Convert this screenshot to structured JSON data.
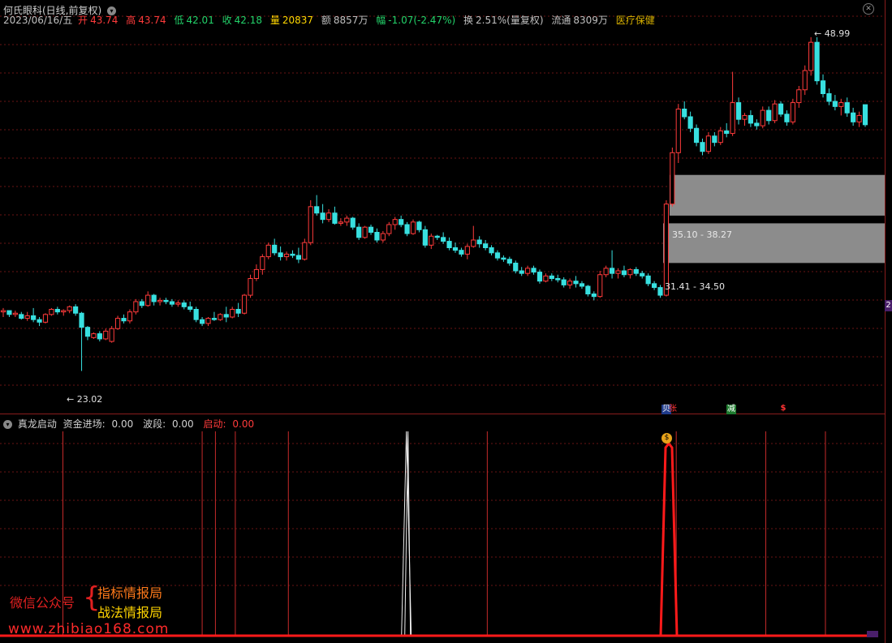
{
  "header": {
    "title": "何氏眼科(日线,前复权)",
    "expand_icon": "chevron-down-icon"
  },
  "quote": {
    "date": "2023/06/16/五",
    "open_label": "开",
    "open": "43.74",
    "high_label": "高",
    "high": "43.74",
    "low_label": "低",
    "low": "42.01",
    "close_label": "收",
    "close": "42.18",
    "vol_label": "量",
    "vol": "20837",
    "amount_label": "额",
    "amount": "8857万",
    "chg_label": "幅",
    "chg": "-1.07(-2.47%)",
    "turnover_label": "换",
    "turnover": "2.51%(量复权)",
    "float_label": "流通",
    "float": "8309万",
    "sector": "医疗保健"
  },
  "annotations": {
    "high_mark": "48.99",
    "low_mark": "23.02",
    "zone_upper": "35.10 - 38.27",
    "zone_lower": "31.41 - 34.50",
    "axis_tag": "2"
  },
  "badges": {
    "buy": "贝",
    "rise": "张",
    "reduce": "减",
    "sell": "$"
  },
  "indicator": {
    "name": "真龙启动",
    "field1_label": "资金进场:",
    "field1": "0.00",
    "field2_label": "波段:",
    "field2": "0.00",
    "field3_label": "启动:",
    "field3": "0.00",
    "marker": "$"
  },
  "watermark": {
    "line1": "微信公众号",
    "brace": "{",
    "line2": "指标情报局",
    "line3": "战法情报局",
    "url": "www.zhibiao168.com"
  },
  "colors": {
    "up": "#ff3b3b",
    "down": "#38e0e0",
    "grid": "#6a1414",
    "zone": "#8c8c8c"
  },
  "chart_data": {
    "type": "candlestick",
    "y_range": [
      20.0,
      50.0
    ],
    "candles": [
      [
        27.6,
        27.9,
        27.2,
        27.7
      ],
      [
        27.7,
        27.7,
        27.2,
        27.4
      ],
      [
        27.4,
        27.7,
        27.2,
        27.5
      ],
      [
        27.4,
        27.6,
        27.0,
        27.1
      ],
      [
        27.1,
        27.6,
        26.9,
        27.3
      ],
      [
        27.3,
        27.9,
        26.8,
        27.0
      ],
      [
        27.0,
        27.2,
        26.5,
        26.8
      ],
      [
        26.8,
        27.5,
        26.7,
        27.4
      ],
      [
        27.4,
        27.9,
        27.3,
        27.8
      ],
      [
        27.8,
        28.0,
        27.4,
        27.6
      ],
      [
        27.6,
        27.8,
        27.3,
        27.7
      ],
      [
        27.7,
        28.1,
        27.5,
        28.0
      ],
      [
        28.0,
        28.2,
        27.3,
        27.5
      ],
      [
        27.5,
        27.6,
        23.0,
        26.4
      ],
      [
        26.4,
        26.5,
        25.4,
        25.7
      ],
      [
        25.6,
        26.0,
        25.5,
        25.9
      ],
      [
        25.9,
        26.1,
        25.3,
        25.5
      ],
      [
        25.5,
        26.3,
        25.4,
        26.1
      ],
      [
        25.3,
        26.5,
        25.2,
        26.3
      ],
      [
        26.3,
        27.3,
        26.2,
        27.1
      ],
      [
        27.1,
        27.4,
        26.7,
        26.9
      ],
      [
        26.9,
        27.8,
        26.7,
        27.6
      ],
      [
        27.6,
        28.6,
        27.4,
        28.4
      ],
      [
        28.4,
        28.6,
        27.9,
        28.1
      ],
      [
        28.1,
        29.2,
        28.0,
        28.9
      ],
      [
        28.9,
        29.0,
        28.1,
        28.4
      ],
      [
        28.4,
        28.7,
        28.1,
        28.5
      ],
      [
        28.5,
        28.7,
        28.2,
        28.4
      ],
      [
        28.4,
        28.6,
        28.0,
        28.2
      ],
      [
        28.2,
        28.5,
        28.0,
        28.3
      ],
      [
        28.3,
        28.5,
        27.8,
        28.0
      ],
      [
        28.0,
        28.4,
        27.6,
        27.8
      ],
      [
        27.8,
        28.0,
        26.8,
        27.0
      ],
      [
        27.0,
        27.2,
        26.5,
        26.7
      ],
      [
        26.7,
        27.2,
        26.5,
        27.1
      ],
      [
        27.1,
        27.6,
        26.9,
        27.0
      ],
      [
        27.0,
        27.5,
        26.9,
        27.4
      ],
      [
        27.4,
        28.0,
        26.8,
        27.2
      ],
      [
        27.2,
        28.0,
        27.1,
        27.8
      ],
      [
        27.8,
        28.3,
        27.2,
        27.5
      ],
      [
        27.5,
        29.0,
        27.4,
        28.9
      ],
      [
        28.9,
        30.5,
        28.7,
        30.2
      ],
      [
        30.2,
        31.3,
        30.0,
        30.9
      ],
      [
        30.9,
        32.1,
        30.5,
        31.9
      ],
      [
        31.9,
        33.0,
        31.7,
        32.8
      ],
      [
        32.8,
        33.3,
        32.0,
        32.2
      ],
      [
        32.2,
        32.7,
        31.6,
        31.9
      ],
      [
        31.9,
        32.3,
        31.6,
        32.1
      ],
      [
        32.1,
        32.4,
        31.8,
        32.0
      ],
      [
        32.0,
        32.6,
        31.4,
        31.7
      ],
      [
        31.7,
        33.3,
        31.6,
        33.0
      ],
      [
        33.0,
        36.3,
        32.8,
        35.8
      ],
      [
        35.8,
        36.7,
        35.1,
        35.3
      ],
      [
        35.3,
        36.0,
        34.5,
        34.8
      ],
      [
        34.8,
        35.6,
        34.6,
        35.3
      ],
      [
        35.3,
        35.8,
        34.4,
        34.5
      ],
      [
        34.5,
        34.9,
        34.3,
        34.6
      ],
      [
        34.6,
        35.1,
        34.3,
        34.9
      ],
      [
        34.9,
        35.0,
        34.0,
        34.2
      ],
      [
        34.2,
        34.5,
        33.2,
        33.4
      ],
      [
        33.4,
        34.3,
        33.3,
        34.2
      ],
      [
        34.2,
        34.4,
        33.6,
        33.8
      ],
      [
        33.8,
        34.1,
        33.0,
        33.2
      ],
      [
        33.2,
        33.9,
        33.0,
        33.7
      ],
      [
        33.7,
        34.6,
        33.5,
        34.4
      ],
      [
        34.4,
        35.0,
        34.0,
        34.8
      ],
      [
        34.8,
        35.1,
        34.2,
        34.4
      ],
      [
        34.4,
        34.6,
        33.5,
        33.7
      ],
      [
        33.7,
        34.8,
        33.6,
        34.6
      ],
      [
        34.6,
        34.7,
        33.8,
        34.0
      ],
      [
        34.0,
        34.3,
        32.6,
        32.8
      ],
      [
        32.8,
        33.7,
        32.5,
        33.5
      ],
      [
        33.5,
        33.6,
        33.2,
        33.4
      ],
      [
        33.4,
        33.8,
        32.9,
        33.1
      ],
      [
        33.1,
        33.4,
        32.4,
        32.6
      ],
      [
        32.6,
        33.0,
        32.2,
        32.4
      ],
      [
        32.4,
        32.6,
        31.9,
        32.1
      ],
      [
        32.1,
        32.9,
        31.7,
        32.7
      ],
      [
        32.7,
        34.3,
        32.6,
        33.2
      ],
      [
        33.2,
        33.5,
        32.6,
        32.9
      ],
      [
        32.9,
        33.2,
        32.4,
        32.6
      ],
      [
        32.6,
        32.8,
        32.0,
        32.2
      ],
      [
        32.2,
        32.4,
        31.6,
        31.8
      ],
      [
        31.8,
        32.0,
        31.5,
        31.7
      ],
      [
        31.7,
        31.9,
        31.2,
        31.4
      ],
      [
        31.4,
        31.6,
        30.6,
        30.8
      ],
      [
        30.8,
        31.1,
        30.4,
        30.6
      ],
      [
        30.6,
        31.2,
        30.4,
        31.0
      ],
      [
        31.0,
        31.2,
        30.5,
        30.7
      ],
      [
        30.7,
        30.9,
        29.8,
        30.0
      ],
      [
        30.0,
        30.6,
        29.9,
        30.4
      ],
      [
        30.4,
        30.6,
        30.0,
        30.2
      ],
      [
        30.2,
        30.5,
        29.9,
        30.1
      ],
      [
        30.1,
        30.3,
        29.5,
        29.7
      ],
      [
        29.7,
        30.2,
        29.4,
        30.0
      ],
      [
        30.0,
        30.4,
        29.5,
        29.8
      ],
      [
        29.8,
        30.0,
        29.4,
        29.6
      ],
      [
        29.6,
        29.7,
        28.8,
        29.0
      ],
      [
        29.0,
        29.2,
        28.5,
        28.8
      ],
      [
        28.8,
        30.8,
        28.7,
        30.5
      ],
      [
        30.5,
        31.2,
        30.3,
        31.0
      ],
      [
        31.0,
        32.4,
        30.2,
        30.6
      ],
      [
        30.6,
        31.0,
        30.2,
        30.8
      ],
      [
        30.8,
        31.2,
        30.3,
        30.5
      ],
      [
        30.5,
        31.0,
        30.2,
        30.9
      ],
      [
        30.9,
        31.1,
        30.4,
        30.6
      ],
      [
        30.6,
        30.8,
        30.2,
        30.4
      ],
      [
        30.4,
        30.6,
        29.6,
        29.8
      ],
      [
        29.8,
        30.0,
        29.3,
        29.5
      ],
      [
        29.5,
        29.7,
        28.7,
        28.9
      ],
      [
        28.9,
        36.3,
        28.8,
        36.0
      ],
      [
        36.0,
        40.4,
        35.8,
        40.0
      ],
      [
        40.0,
        43.8,
        39.2,
        43.4
      ],
      [
        43.4,
        44.0,
        42.6,
        42.8
      ],
      [
        42.8,
        43.2,
        41.6,
        41.9
      ],
      [
        41.9,
        42.2,
        40.5,
        40.8
      ],
      [
        40.8,
        41.1,
        39.8,
        40.1
      ],
      [
        40.1,
        41.6,
        39.9,
        41.3
      ],
      [
        41.3,
        41.6,
        40.5,
        40.8
      ],
      [
        40.8,
        42.0,
        40.6,
        41.7
      ],
      [
        41.7,
        42.3,
        41.2,
        41.5
      ],
      [
        41.5,
        46.3,
        41.3,
        43.9
      ],
      [
        43.9,
        44.3,
        42.2,
        42.6
      ],
      [
        42.6,
        43.1,
        42.1,
        42.9
      ],
      [
        42.9,
        43.3,
        42.0,
        42.3
      ],
      [
        42.3,
        42.6,
        41.8,
        42.1
      ],
      [
        42.1,
        43.6,
        41.9,
        43.3
      ],
      [
        43.3,
        43.6,
        42.2,
        42.5
      ],
      [
        42.5,
        44.1,
        42.3,
        43.8
      ],
      [
        43.8,
        44.0,
        42.8,
        43.0
      ],
      [
        43.0,
        43.3,
        42.1,
        42.4
      ],
      [
        42.4,
        44.2,
        42.2,
        43.9
      ],
      [
        43.9,
        45.2,
        43.5,
        44.9
      ],
      [
        44.9,
        46.8,
        44.5,
        46.4
      ],
      [
        46.4,
        49.0,
        46.0,
        48.6
      ],
      [
        48.6,
        49.0,
        45.3,
        45.6
      ],
      [
        45.6,
        46.1,
        44.3,
        44.6
      ],
      [
        44.6,
        45.0,
        43.7,
        44.0
      ],
      [
        44.0,
        44.5,
        43.3,
        43.6
      ],
      [
        43.6,
        44.2,
        42.9,
        43.9
      ],
      [
        43.9,
        44.3,
        42.8,
        43.1
      ],
      [
        43.1,
        43.5,
        42.1,
        42.4
      ],
      [
        42.4,
        43.2,
        42.0,
        42.9
      ],
      [
        43.74,
        43.74,
        42.01,
        42.18
      ]
    ],
    "zones": [
      {
        "low": 35.1,
        "high": 38.27
      },
      {
        "low": 31.41,
        "high": 34.5
      }
    ],
    "indicator": {
      "spike_line_x_index": [
        16,
        17
      ],
      "red_lines_index": [
        18,
        60,
        64,
        70,
        86,
        146,
        203,
        230,
        248
      ],
      "main_spike_index": 205,
      "max": 100
    }
  }
}
